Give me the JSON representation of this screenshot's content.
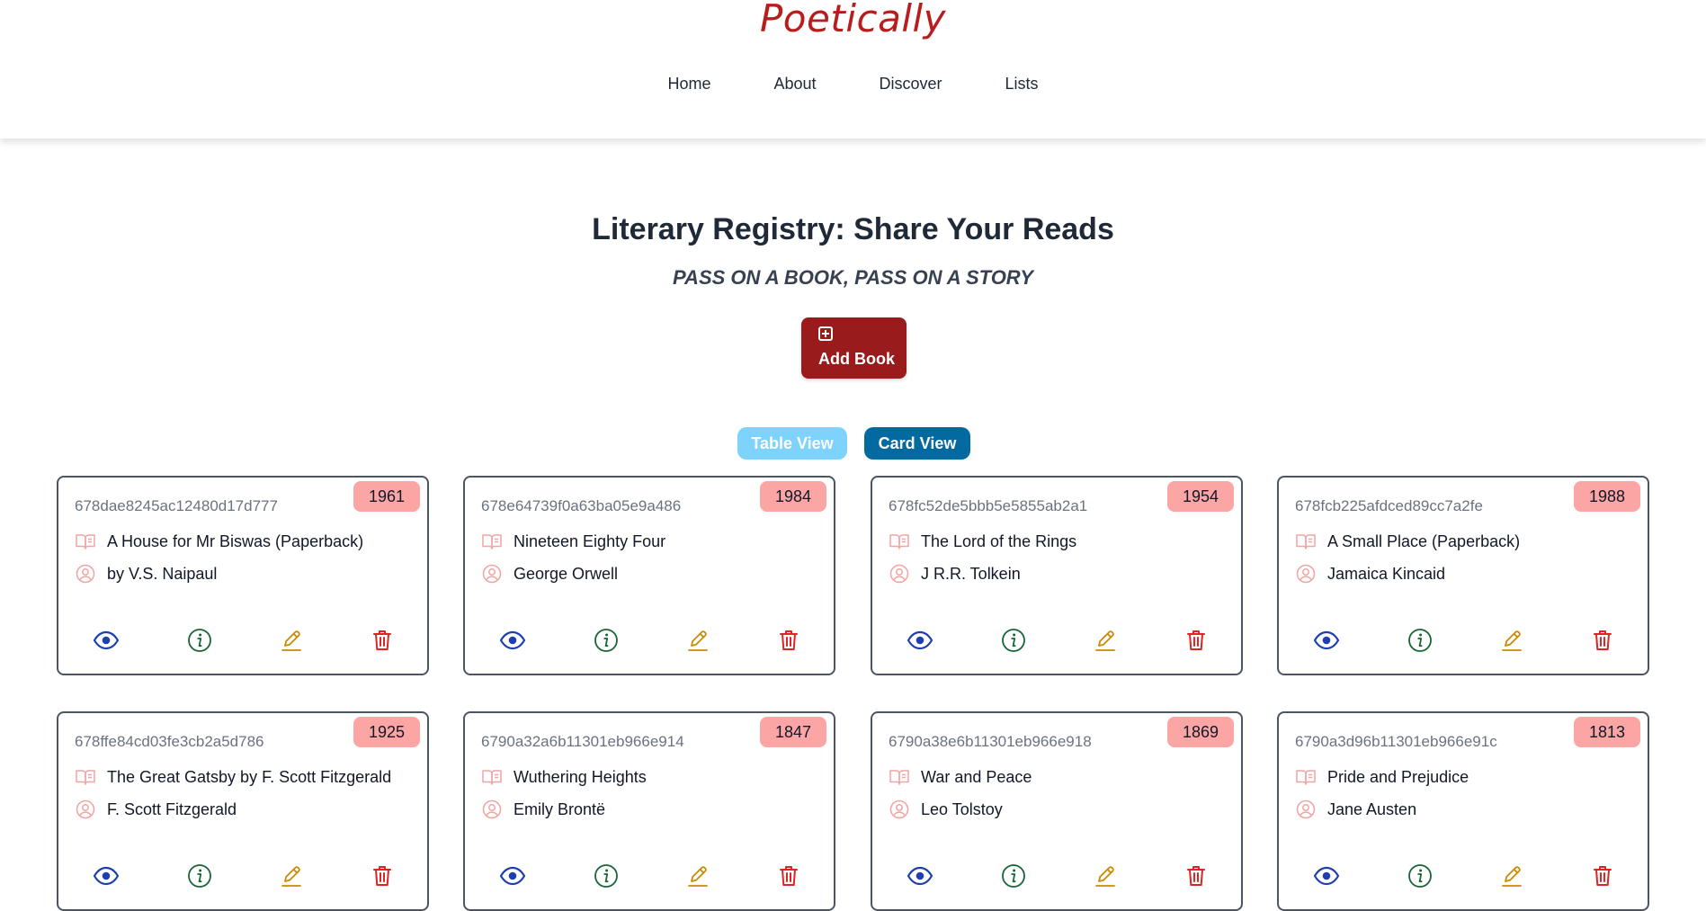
{
  "brand": "Poetically",
  "nav": [
    "Home",
    "About",
    "Discover",
    "Lists"
  ],
  "hero": {
    "title": "Literary Registry: Share Your Reads",
    "subtitle": "PASS ON A BOOK, PASS ON A STORY",
    "add_button": "Add Book"
  },
  "views": {
    "table": "Table View",
    "card": "Card View",
    "active": "card"
  },
  "colors": {
    "brand": "#b91c1c",
    "add_button": "#991b1b",
    "table_view": "#7dd3fc",
    "card_view": "#0369a1",
    "year_badge": "#fca5a5",
    "icon_pink": "#f4a3a3",
    "view": "#1e40af",
    "info": "#166534",
    "edit": "#ca8a04",
    "delete": "#dc2626"
  },
  "icons": {
    "title": "open-book-icon",
    "author": "user-circle-icon",
    "actions": [
      "eye-icon",
      "info-icon",
      "pencil-icon",
      "trash-icon"
    ]
  },
  "books": [
    {
      "id": "678dae8245ac12480d17d777",
      "year": "1961",
      "title": "A House for Mr Biswas (Paperback)",
      "author": "by V.S. Naipaul"
    },
    {
      "id": "678e64739f0a63ba05e9a486",
      "year": "1984",
      "title": "Nineteen Eighty Four",
      "author": "George Orwell"
    },
    {
      "id": "678fc52de5bbb5e5855ab2a1",
      "year": "1954",
      "title": "The Lord of the Rings",
      "author": "J R.R. Tolkein"
    },
    {
      "id": "678fcb225afdced89cc7a2fe",
      "year": "1988",
      "title": "A Small Place (Paperback)",
      "author": "Jamaica Kincaid"
    },
    {
      "id": "678ffe84cd03fe3cb2a5d786",
      "year": "1925",
      "title": "The Great Gatsby by F. Scott Fitzgerald",
      "author": "F. Scott Fitzgerald"
    },
    {
      "id": "6790a32a6b11301eb966e914",
      "year": "1847",
      "title": "Wuthering Heights",
      "author": "Emily Brontë"
    },
    {
      "id": "6790a38e6b11301eb966e918",
      "year": "1869",
      "title": "War and Peace",
      "author": "Leo Tolstoy"
    },
    {
      "id": "6790a3d96b11301eb966e91c",
      "year": "1813",
      "title": "Pride and Prejudice",
      "author": "Jane Austen"
    }
  ]
}
